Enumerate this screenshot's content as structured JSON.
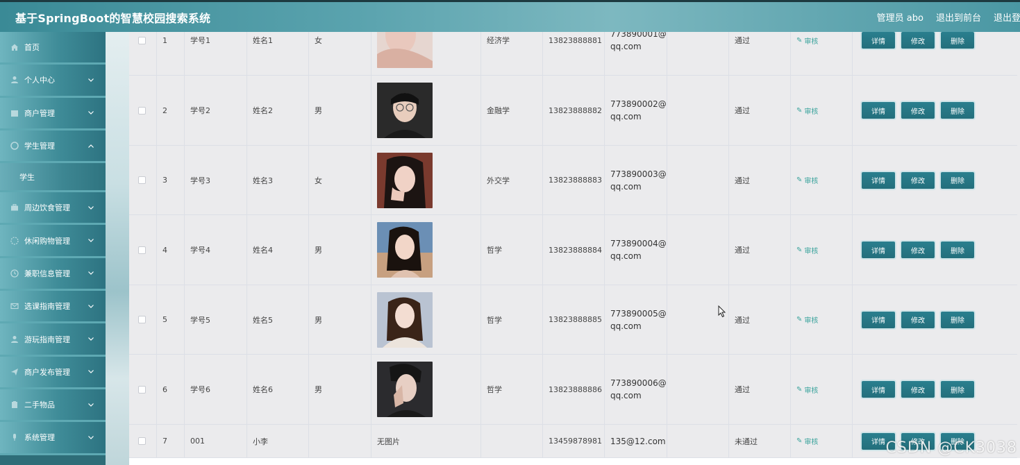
{
  "app": {
    "title": "基于SpringBoot的智慧校园搜索系统",
    "admin_label": "管理员 abo",
    "back_to_front": "退出到前台",
    "logout": "退出登录"
  },
  "sidebar": {
    "items": [
      {
        "label": "首页",
        "icon": "home-icon"
      },
      {
        "label": "个人中心",
        "icon": "user-icon"
      },
      {
        "label": "商户管理",
        "icon": "shop-icon"
      },
      {
        "label": "学生管理",
        "icon": "student-icon",
        "expanded": true
      },
      {
        "label": "周边饮食管理",
        "icon": "briefcase-icon"
      },
      {
        "label": "休闲购物管理",
        "icon": "shopping-icon"
      },
      {
        "label": "兼职信息管理",
        "icon": "clock-icon"
      },
      {
        "label": "选课指南管理",
        "icon": "mail-icon"
      },
      {
        "label": "游玩指南管理",
        "icon": "user-icon"
      },
      {
        "label": "商户发布管理",
        "icon": "send-icon"
      },
      {
        "label": "二手物品",
        "icon": "clipboard-icon"
      },
      {
        "label": "系统管理",
        "icon": "mic-icon"
      }
    ],
    "submenu": {
      "label": "学生"
    }
  },
  "table": {
    "rows": [
      {
        "index": "1",
        "student_no": "学号1",
        "name": "姓名1",
        "gender": "女",
        "photo": "photo-1",
        "major": "经济学",
        "phone": "13823888881",
        "email_line1": "773890001@",
        "email_line2": "qq.com",
        "status": "通过",
        "audit": "审核"
      },
      {
        "index": "2",
        "student_no": "学号2",
        "name": "姓名2",
        "gender": "男",
        "photo": "photo-2",
        "major": "金融学",
        "phone": "13823888882",
        "email_line1": "773890002@",
        "email_line2": "qq.com",
        "status": "通过",
        "audit": "审核"
      },
      {
        "index": "3",
        "student_no": "学号3",
        "name": "姓名3",
        "gender": "女",
        "photo": "photo-3",
        "major": "外交学",
        "phone": "13823888883",
        "email_line1": "773890003@",
        "email_line2": "qq.com",
        "status": "通过",
        "audit": "审核"
      },
      {
        "index": "4",
        "student_no": "学号4",
        "name": "姓名4",
        "gender": "男",
        "photo": "photo-4",
        "major": "哲学",
        "phone": "13823888884",
        "email_line1": "773890004@",
        "email_line2": "qq.com",
        "status": "通过",
        "audit": "审核"
      },
      {
        "index": "5",
        "student_no": "学号5",
        "name": "姓名5",
        "gender": "男",
        "photo": "photo-5",
        "major": "哲学",
        "phone": "13823888885",
        "email_line1": "773890005@",
        "email_line2": "qq.com",
        "status": "通过",
        "audit": "审核"
      },
      {
        "index": "6",
        "student_no": "学号6",
        "name": "姓名6",
        "gender": "男",
        "photo": "photo-6",
        "major": "哲学",
        "phone": "13823888886",
        "email_line1": "773890006@",
        "email_line2": "qq.com",
        "status": "通过",
        "audit": "审核"
      },
      {
        "index": "7",
        "student_no": "001",
        "name": "小李",
        "gender": "",
        "photo_text": "无图片",
        "major": "",
        "phone": "13459878981",
        "email_line1": "135@12.com",
        "email_line2": "",
        "status": "未通过",
        "audit": "审核"
      }
    ],
    "actions": {
      "detail": "详情",
      "edit": "修改",
      "delete": "删除"
    }
  },
  "watermark": "CSDN @CK3038",
  "colors": {
    "primary": "#2a7f8e",
    "sidebar": "#3f8c98",
    "audit": "#3aa39c"
  }
}
